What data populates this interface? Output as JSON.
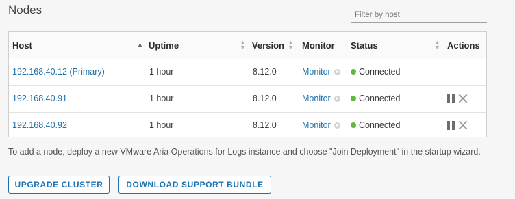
{
  "page": {
    "title": "Nodes"
  },
  "filter": {
    "placeholder": "Filter by host",
    "value": ""
  },
  "table": {
    "columns": [
      {
        "label": "Host",
        "sort": "ascending"
      },
      {
        "label": "Uptime",
        "sort": "sortable"
      },
      {
        "label": "Version",
        "sort": "sortable"
      },
      {
        "label": "Monitor",
        "sort": "none"
      },
      {
        "label": "Status",
        "sort": "sortable"
      },
      {
        "label": "Actions",
        "sort": "none"
      }
    ],
    "rows": [
      {
        "host": "192.168.40.12 (Primary)",
        "uptime": "1 hour",
        "version": "8.12.0",
        "monitor": "Monitor",
        "status": "Connected",
        "actions": []
      },
      {
        "host": "192.168.40.91",
        "uptime": "1 hour",
        "version": "8.12.0",
        "monitor": "Monitor",
        "status": "Connected",
        "actions": [
          "pause-icon",
          "close-icon"
        ]
      },
      {
        "host": "192.168.40.92",
        "uptime": "1 hour",
        "version": "8.12.0",
        "monitor": "Monitor",
        "status": "Connected",
        "actions": [
          "pause-icon",
          "close-icon"
        ]
      }
    ]
  },
  "note": "To add a node, deploy a new VMware Aria Operations for Logs instance and choose \"Join Deployment\" in the startup wizard.",
  "buttons": {
    "upgrade": "UPGRADE CLUSTER",
    "download": "DOWNLOAD SUPPORT BUNDLE"
  },
  "colors": {
    "link": "#1f6fa8",
    "status_connected": "#62b83a",
    "button": "#1a72b0"
  }
}
